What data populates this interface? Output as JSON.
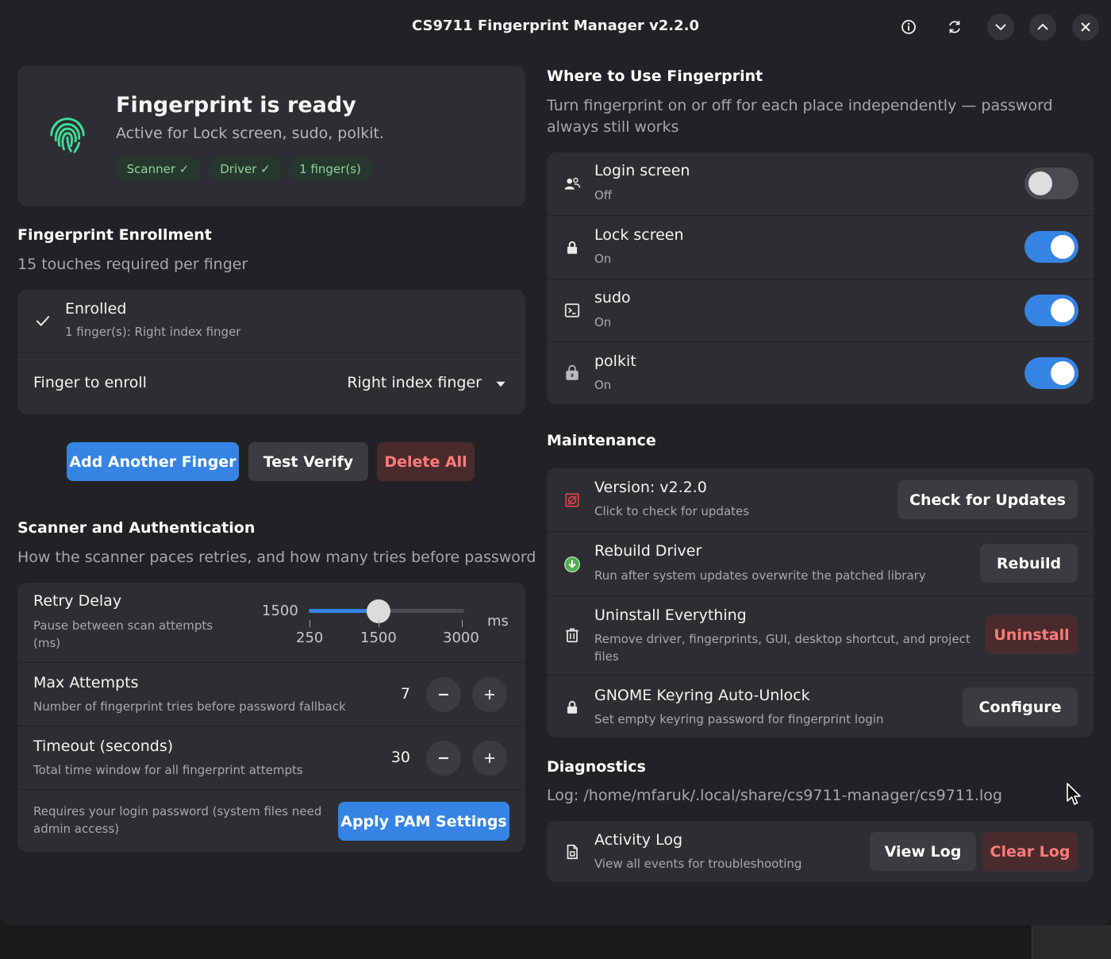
{
  "window": {
    "title": "CS9711 Fingerprint Manager v2.2.0",
    "header_buttons": [
      "info-icon",
      "refresh-icon",
      "chevron-down-icon",
      "chevron-up-icon",
      "close-icon"
    ]
  },
  "status": {
    "title": "Fingerprint is ready",
    "subtitle": "Active for Lock screen, sudo, polkit.",
    "pills": [
      "Scanner ✓",
      "Driver ✓",
      "1 finger(s)"
    ]
  },
  "enrollment": {
    "heading": "Fingerprint Enrollment",
    "description": "15 touches required per finger",
    "enrolled_title": "Enrolled",
    "enrolled_sub": "1 finger(s): Right index finger",
    "finger_label": "Finger to enroll",
    "finger_value": "Right index finger",
    "buttons": {
      "add": "Add Another Finger",
      "test": "Test Verify",
      "delete": "Delete All"
    }
  },
  "scanner": {
    "heading": "Scanner and Authentication",
    "description": "How the scanner paces retries, and how many tries before password",
    "retry": {
      "title": "Retry Delay",
      "sub": "Pause between scan attempts (ms)",
      "value": 1500,
      "value_label": "1500",
      "min": 250,
      "max": 3000,
      "unit": "ms",
      "marks": [
        "250",
        "1500",
        "3000"
      ]
    },
    "max_attempts": {
      "title": "Max Attempts",
      "sub": "Number of fingerprint tries before password fallback",
      "value": "7"
    },
    "timeout": {
      "title": "Timeout (seconds)",
      "sub": "Total time window for all fingerprint attempts",
      "value": "30"
    },
    "apply_note": "Requires your login password (system files need admin access)",
    "apply_button": "Apply PAM Settings"
  },
  "where": {
    "heading": "Where to Use Fingerprint",
    "description": "Turn fingerprint on or off for each place independently — password always still works",
    "items": [
      {
        "title": "Login screen",
        "state": "Off",
        "on": false,
        "icon": "users-icon"
      },
      {
        "title": "Lock screen",
        "state": "On",
        "on": true,
        "icon": "lock-icon"
      },
      {
        "title": "sudo",
        "state": "On",
        "on": true,
        "icon": "terminal-icon"
      },
      {
        "title": "polkit",
        "state": "On",
        "on": true,
        "icon": "shield-lock-icon"
      }
    ]
  },
  "maintenance": {
    "heading": "Maintenance",
    "items": [
      {
        "title": "Version: v2.2.0",
        "sub": "Click to check for updates",
        "button": "Check for Updates",
        "icon": "update-icon"
      },
      {
        "title": "Rebuild Driver",
        "sub": "Run after system updates overwrite the patched library",
        "button": "Rebuild",
        "icon": "download-icon"
      },
      {
        "title": "Uninstall Everything",
        "sub": "Remove driver, fingerprints, GUI, desktop shortcut, and project files",
        "button": "Uninstall",
        "icon": "trash-icon"
      },
      {
        "title": "GNOME Keyring Auto-Unlock",
        "sub": "Set empty keyring password for fingerprint login",
        "button": "Configure",
        "icon": "lock-icon"
      }
    ]
  },
  "diagnostics": {
    "heading": "Diagnostics",
    "log_path": "Log: /home/mfaruk/.local/share/cs9711-manager/cs9711.log",
    "activity_title": "Activity Log",
    "activity_sub": "View all events for troubleshooting",
    "view_button": "View Log",
    "clear_button": "Clear Log"
  },
  "colors": {
    "accent": "#3584e4",
    "destructive": "#ff7b7b",
    "success": "#8fd29f",
    "fingerprint": "#3ddc97"
  }
}
